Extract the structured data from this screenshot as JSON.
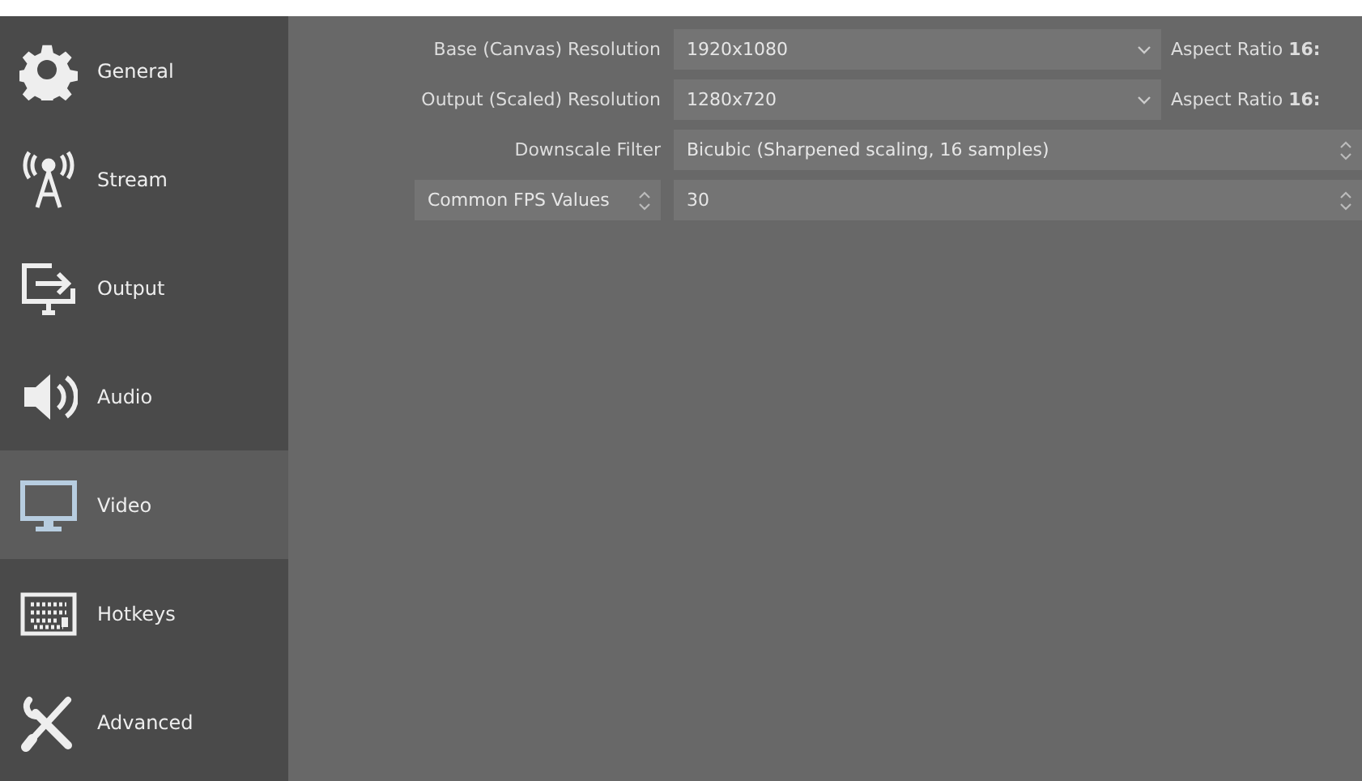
{
  "sidebar": {
    "items": [
      {
        "label": "General",
        "kind": "gear",
        "selected": false
      },
      {
        "label": "Stream",
        "kind": "antenna",
        "selected": false
      },
      {
        "label": "Output",
        "kind": "output",
        "selected": false
      },
      {
        "label": "Audio",
        "kind": "speaker",
        "selected": false
      },
      {
        "label": "Video",
        "kind": "monitor",
        "selected": true
      },
      {
        "label": "Hotkeys",
        "kind": "keyboard",
        "selected": false
      },
      {
        "label": "Advanced",
        "kind": "tools",
        "selected": false
      }
    ]
  },
  "settings": [
    {
      "kind": "dropdown",
      "label": "Base (Canvas) Resolution",
      "value": "1920x1080",
      "aspect": "Aspect Ratio **16:**"
    },
    {
      "kind": "dropdown",
      "label": "Output (Scaled) Resolution",
      "value": "1280x720",
      "aspect": "Aspect Ratio **16:**"
    },
    {
      "kind": "spinner",
      "label": "Downscale Filter",
      "value": "Bicubic (Sharpened scaling, 16 samples)"
    },
    {
      "kind": "spinner",
      "label_select": "Common FPS Values",
      "value": "30"
    }
  ]
}
